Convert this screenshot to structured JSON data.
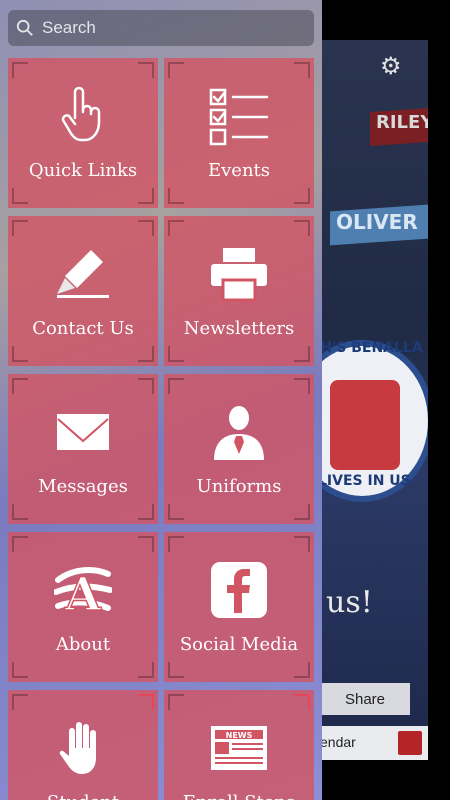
{
  "search": {
    "placeholder": "Search"
  },
  "menu": {
    "tiles": [
      {
        "label": "Quick Links",
        "icon": "pointer-hand-icon"
      },
      {
        "label": "Events",
        "icon": "checklist-icon"
      },
      {
        "label": "Contact Us",
        "icon": "pencil-edit-icon"
      },
      {
        "label": "Newsletters",
        "icon": "printer-icon"
      },
      {
        "label": "Messages",
        "icon": "envelope-icon"
      },
      {
        "label": "Uniforms",
        "icon": "person-tie-icon"
      },
      {
        "label": "About",
        "icon": "letter-a-icon"
      },
      {
        "label": "Social Media",
        "icon": "facebook-icon"
      },
      {
        "label": "Student",
        "icon": "hand-icon"
      },
      {
        "label": "Enroll Steps",
        "icon": "newspaper-icon"
      }
    ]
  },
  "background_app": {
    "banner_text_1": "RILEY",
    "banner_text_2": "OLIVER",
    "logo_text_top": "PH'S BENALLA",
    "logo_text_bottom": "LIVES IN US",
    "script_text": "us!",
    "share_label": "Share",
    "calendar_label": "endar"
  },
  "colors": {
    "tile": "#d25564",
    "drawer": "#8f8fb4"
  }
}
